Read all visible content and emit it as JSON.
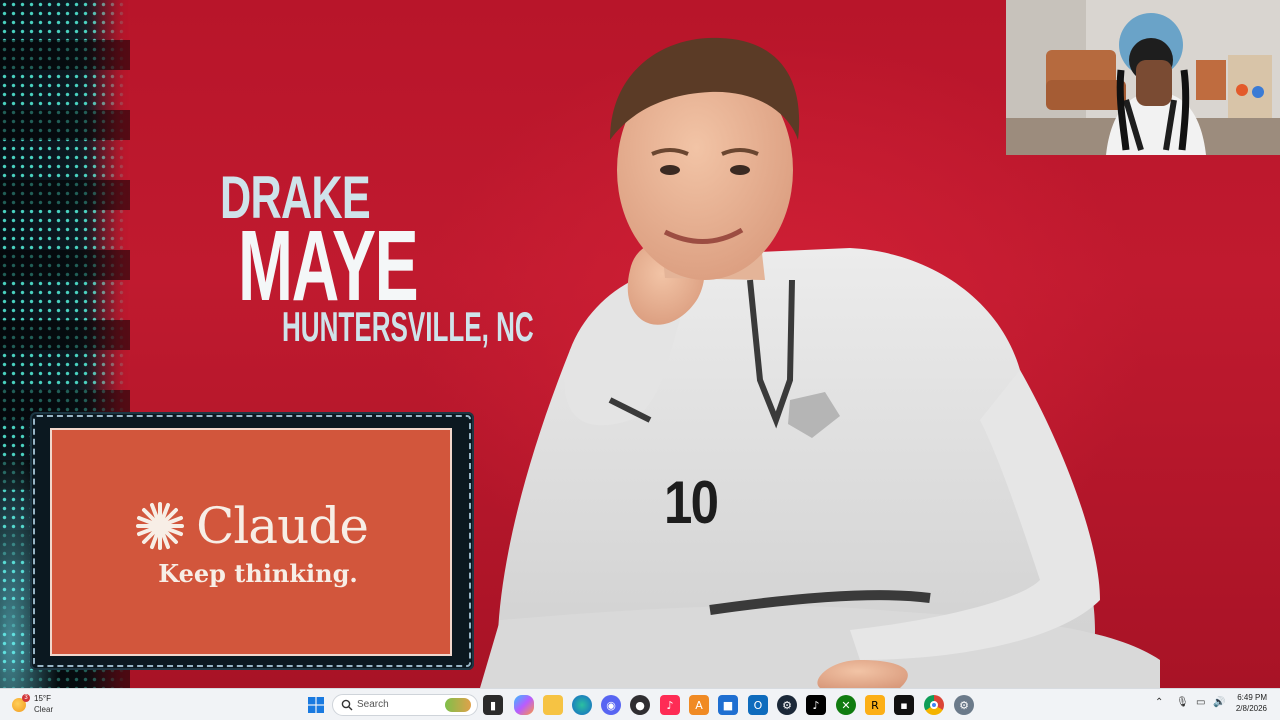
{
  "overlay": {
    "first_name": "DRAKE",
    "last_name": "MAYE",
    "hometown": "HUNTERSVILLE, NC",
    "jersey_number": "10"
  },
  "ad": {
    "brand": "Claude",
    "tagline": "Keep thinking.",
    "logo_icon": "starburst-icon",
    "background_color": "#d2563c"
  },
  "taskbar": {
    "weather": {
      "badge": "3",
      "temperature": "15°F",
      "condition": "Clear",
      "icon": "sun-icon"
    },
    "search": {
      "placeholder": "Search"
    },
    "pinned_apps": [
      {
        "name": "start-button",
        "icon": "windows-logo-icon"
      },
      {
        "name": "task-view",
        "icon": "task-view-icon"
      },
      {
        "name": "copilot",
        "icon": "copilot-icon"
      },
      {
        "name": "file-explorer",
        "icon": "folder-icon"
      },
      {
        "name": "edge",
        "icon": "edge-icon"
      },
      {
        "name": "discord",
        "icon": "discord-icon"
      },
      {
        "name": "obs",
        "icon": "obs-icon"
      },
      {
        "name": "tiktok-studio",
        "icon": "tiktok-icon"
      },
      {
        "name": "app-a",
        "icon": "a-app-icon"
      },
      {
        "name": "store",
        "icon": "store-icon"
      },
      {
        "name": "outlook",
        "icon": "outlook-icon"
      },
      {
        "name": "steam",
        "icon": "steam-icon"
      },
      {
        "name": "tiktok",
        "icon": "tiktok-icon"
      },
      {
        "name": "xbox",
        "icon": "xbox-icon"
      },
      {
        "name": "rockstar",
        "icon": "rockstar-icon"
      },
      {
        "name": "game-app",
        "icon": "game-icon"
      },
      {
        "name": "chrome",
        "icon": "chrome-icon"
      },
      {
        "name": "settings",
        "icon": "gear-icon"
      }
    ],
    "clock": {
      "time": "6:49 PM",
      "date": "2/8/2026"
    }
  }
}
